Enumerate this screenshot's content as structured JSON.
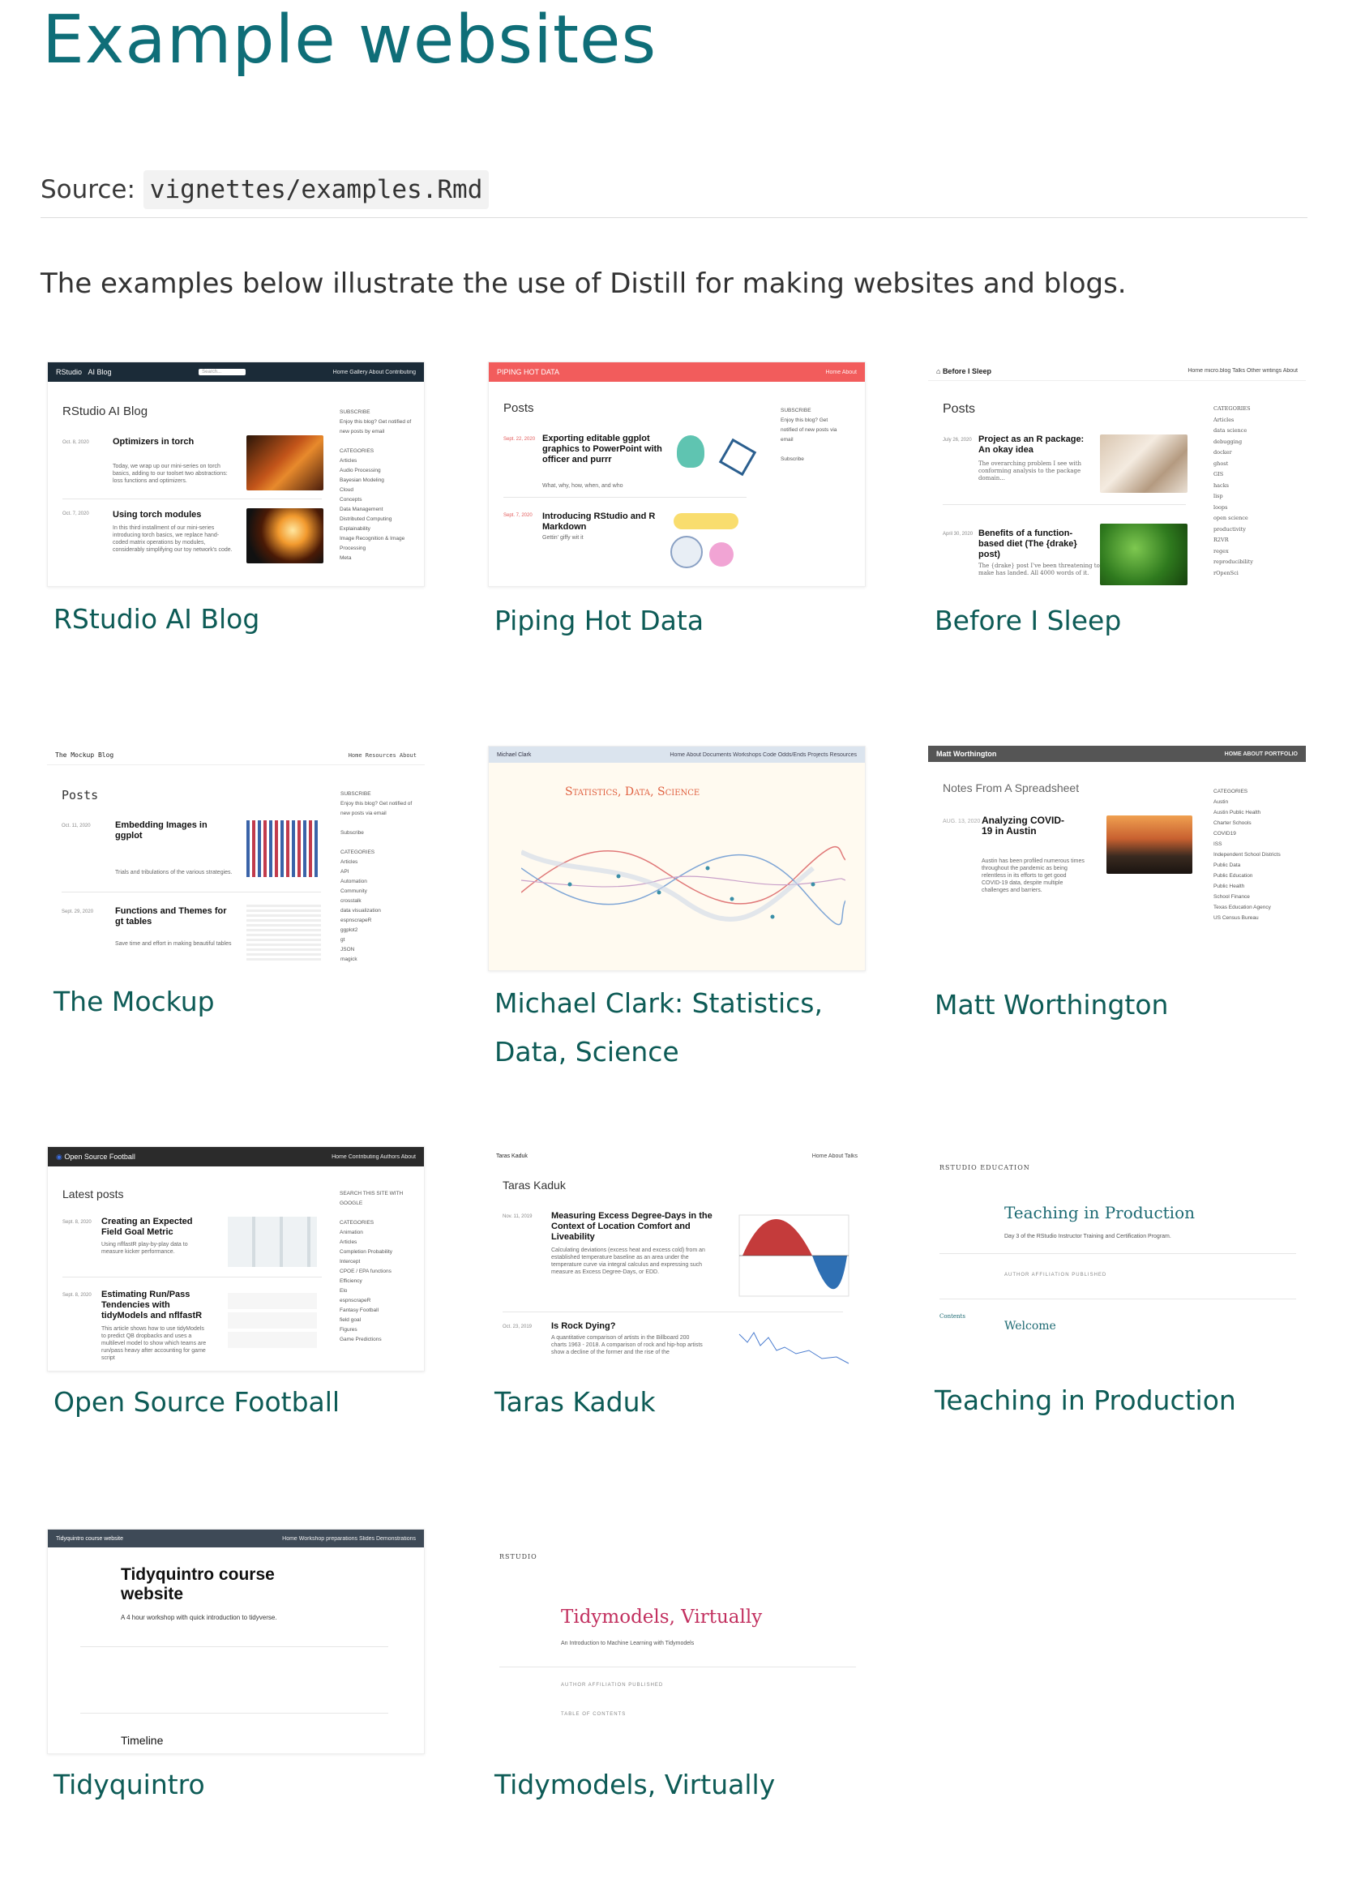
{
  "page": {
    "title": "Example websites",
    "source_label": "Source:",
    "source_path": "vignettes/examples.Rmd",
    "intro": "The examples below illustrate the use of Distill for making websites and blogs."
  },
  "colors": {
    "heading": "#0f6e78",
    "caption": "#0d5b56"
  },
  "examples": [
    {
      "caption": "RStudio AI Blog",
      "thumb": {
        "brand": "RStudio",
        "brand2": "AI Blog",
        "search": "Search...",
        "nav": "Home   Gallery   About   Contributing",
        "heading": "RStudio AI Blog",
        "posts": [
          {
            "date": "Oct. 8, 2020",
            "title": "Optimizers in torch",
            "desc": "Today, we wrap up our mini-series on torch basics, adding to our toolset two abstractions: loss functions and optimizers."
          },
          {
            "date": "Oct. 7, 2020",
            "title": "Using torch modules",
            "desc": "In this third installment of our mini-series introducing torch basics, we replace hand-coded matrix operations by modules, considerably simplifying our toy network's code."
          }
        ],
        "sidebar": "SUBSCRIBE\nEnjoy this blog? Get notified of new posts by email\n\nCATEGORIES\nArticles\nAudio Processing\nBayesian Modeling\nCloud\nConcepts\nData Management\nDistributed Computing\nExplainability\nImage Recognition & Image Processing\nMeta"
      }
    },
    {
      "caption": "Piping Hot Data",
      "thumb": {
        "brand": "PIPING HOT DATA",
        "nav": "Home   About",
        "heading": "Posts",
        "posts": [
          {
            "date": "Sept. 22, 2020",
            "title": "Exporting editable ggplot graphics to PowerPoint with officer and purrr",
            "desc": "What, why, how, when, and who"
          },
          {
            "date": "Sept. 7, 2020",
            "title": "Introducing RStudio and R Markdown",
            "desc": "Gettin' giffy wit it"
          }
        ],
        "sidebar": "SUBSCRIBE\nEnjoy this blog? Get notified of new posts via email\n\nSubscribe"
      }
    },
    {
      "caption": "Before I Sleep",
      "thumb": {
        "brand": "Before I Sleep",
        "nav": "Home   micro.blog   Talks   Other writings   About",
        "heading": "Posts",
        "posts": [
          {
            "date": "July 26, 2020",
            "title": "Project as an R package: An okay idea",
            "desc": "The overarching problem I see with conforming analysis to the package domain..."
          },
          {
            "date": "April 30, 2020",
            "title": "Benefits of a function-based diet (The {drake} post)",
            "desc": "The {drake} post I've been threatening to make has landed. All 4000 words of it."
          }
        ],
        "sidebar": "CATEGORIES\nArticles\ndata science\ndebugging\ndocker\nghost\nGIS\nhacks\nlisp\nloops\nopen science\nproductivity\nR2VR\nregex\nreproducibility\nrOpenSci"
      }
    },
    {
      "caption": "The Mockup",
      "thumb": {
        "brand": "The Mockup Blog",
        "nav": "Home   Resources   About",
        "heading": "Posts",
        "posts": [
          {
            "date": "Oct. 11, 2020",
            "title": "Embedding Images in ggplot",
            "desc": "Trials and tribulations of the various strategies."
          },
          {
            "date": "Sept. 29, 2020",
            "title": "Functions and Themes for gt tables",
            "desc": "Save time and effort in making beautiful tables"
          }
        ],
        "sidebar": "SUBSCRIBE\nEnjoy this blog? Get notified of new posts via email\n\nSubscribe\n\nCATEGORIES\nArticles\nAPI\nAutomation\nCommunity\ncrosstalk\ndata visualization\nespnscrapeR\nggplot2\ngt\nJSON\nmagick"
      }
    },
    {
      "caption": "Michael Clark: Statistics, Data, Science",
      "thumb": {
        "brand": "Michael Clark",
        "nav": "Home   About   Documents   Workshops   Code   Odds/Ends   Projects   Resources",
        "heading": "Statistics, Data, Science"
      }
    },
    {
      "caption": "Matt Worthington",
      "thumb": {
        "brand": "Matt Worthington",
        "nav": "HOME   ABOUT   PORTFOLIO",
        "heading": "Notes From A Spreadsheet",
        "posts": [
          {
            "date": "AUG. 13, 2020",
            "title": "Analyzing COVID-19 in Austin",
            "desc": "Austin has been profiled numerous times throughout the pandemic as being relentless in its efforts to get good COVID-19 data, despite multiple challenges and barriers."
          }
        ],
        "sidebar": "CATEGORIES\nAustin\nAustin Public Health\nCharter Schools\nCOVID19\nISS\nIndependent School Districts\nPublic Data\nPublic Education\nPublic Health\nSchool Finance\nTexas Education Agency\nUS Census Bureau"
      }
    },
    {
      "caption": "Open Source Football",
      "thumb": {
        "brand": "Open Source Football",
        "nav": "Home   Contributing   Authors   About",
        "heading": "Latest posts",
        "posts": [
          {
            "date": "Sept. 8, 2020",
            "title": "Creating an Expected Field Goal Metric",
            "desc": "Using nflfastR play-by-play data to measure kicker performance."
          },
          {
            "date": "Sept. 8, 2020",
            "title": "Estimating Run/Pass Tendencies with tidyModels and nflfastR",
            "desc": "This article shows how to use tidyModels to predict QB dropbacks and uses a multilevel model to show which teams are run/pass heavy after accounting for game script"
          }
        ],
        "sidebar": "SEARCH THIS SITE WITH GOOGLE\n\nCATEGORIES\nAnimation\nArticles\nCompletion Probability\nIntercept\nCPOE / EPA functions\nEfficiency\nElo\nespnscrapeR\nFantasy Football\nfield goal\nFigures\nGame Predictions"
      }
    },
    {
      "caption": "Taras Kaduk",
      "thumb": {
        "brand": "Taras Kaduk",
        "nav": "Home   About   Talks",
        "heading": "Taras Kaduk",
        "posts": [
          {
            "date": "Nov. 11, 2019",
            "title": "Measuring Excess Degree-Days in the Context of Location Comfort and Liveability",
            "desc": "Calculating deviations (excess heat and excess cold) from an established temperature baseline as an area under the temperature curve via integral calculus and expressing such measure as Excess Degree-Days, or EDD."
          },
          {
            "date": "Oct. 23, 2019",
            "title": "Is Rock Dying?",
            "desc": "A quantitative comparison of artists in the Billboard 200 charts 1963 - 2018. A comparison of rock and hip-hop artists show a decline of the former and the rise of the"
          }
        ]
      }
    },
    {
      "caption": "Teaching in Production",
      "thumb": {
        "brand": "RSTUDIO EDUCATION",
        "heading": "Teaching in Production",
        "subtitle": "Day 3 of the RStudio Instructor Training and Certification Program.",
        "meta": "AUTHOR   AFFILIATION   PUBLISHED",
        "contents": "Contents",
        "welcome": "Welcome"
      }
    },
    {
      "caption": "Tidyquintro",
      "thumb": {
        "brand": "Tidyquintro course website",
        "nav": "Home   Workshop preparations   Slides   Demonstrations",
        "heading": "Tidyquintro course website",
        "subtitle": "A 4 hour workshop with quick introduction to tidyverse.",
        "section": "Timeline"
      }
    },
    {
      "caption": "Tidymodels, Virtually",
      "thumb": {
        "brand": "RSTUDIO",
        "heading": "Tidymodels, Virtually",
        "subtitle": "An Introduction to Machine Learning with Tidymodels",
        "meta": "AUTHOR   AFFILIATION   PUBLISHED",
        "toc": "TABLE OF CONTENTS"
      }
    }
  ]
}
